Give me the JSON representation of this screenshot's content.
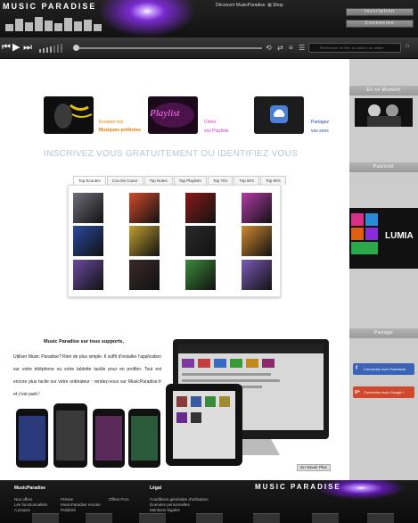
{
  "header": {
    "logo": "MUSIC PARADISE",
    "nav": [
      "Découvrir  MusicParadise",
      "Shop"
    ],
    "nav_chevron": "˅",
    "signup": "Inscription",
    "login": "Connexion"
  },
  "player": {
    "search_placeholder": "Rechercher un titre, un album, un artiste",
    "prev": "⏮",
    "play": "▶",
    "next": "⏭"
  },
  "features": [
    {
      "line1": "Ecoutez vos",
      "line2": "Musiques préférées",
      "color1": "#e07b00",
      "color2": "#e07b00"
    },
    {
      "line1": "Créez",
      "line2": "vos Playlists",
      "image_text": "Playlist",
      "color1": "#c832c8",
      "color2": "#c832c8"
    },
    {
      "line1": "Partagez",
      "line2": "vos sons",
      "color1": "#2050a0",
      "color2": "#2050a0"
    }
  ],
  "cta_title": "INSCRIVEZ VOUS GRATUITEMENT OU IDENTIFIEZ VOUS",
  "tabs": [
    "Top Ecoutes",
    "Cou De Coeur",
    "Top Notes",
    "Top Playlists",
    "Top 70's",
    "Top 80's",
    "Top 90's"
  ],
  "covers": [
    "#6e6e7a",
    "#d24a2a",
    "#8a1a1a",
    "#b23aa8",
    "#2a4aa0",
    "#c0a030",
    "#2a2a2a",
    "#d08a30",
    "#6a4aa0",
    "#3a2a2a",
    "#3a8a3a",
    "#7a5ab8"
  ],
  "promo": {
    "heading": "Music Paradise sur tous supports,",
    "body": "Utiliser Music Paradise? Rien de plus simple. Il suffit d'installer l'application sur votre téléphone ou votre tablette tactile pour en profiter. Tout est encore plus facile sur votre ordinateur : rendez-vous sur MusicParadise.fr et c'est parti !",
    "more": "En Savoir Plus"
  },
  "sidebar": {
    "moment": "En ce Moment",
    "ad": "Publicité",
    "share": "Partage",
    "ad_text": "LUMIA",
    "facebook": "Connexion avec Facebook",
    "google": "Connexion avec Google +",
    "facebook_icon": "f",
    "google_icon": "g+"
  },
  "footer": {
    "col1_title": "MusicParadise",
    "col1": [
      "Nos offres",
      "Les fonctionnalités",
      "A propos"
    ],
    "col2": [
      "Presse",
      "MusicParadise recrute",
      "Publicité"
    ],
    "col3": [
      "Offres Pros"
    ],
    "col4_title": "Légal",
    "col4": [
      "Conditions générales d'utilisation",
      "Données personnelles",
      "Mentions légales"
    ],
    "logo": "MUSIC PARADISE"
  }
}
